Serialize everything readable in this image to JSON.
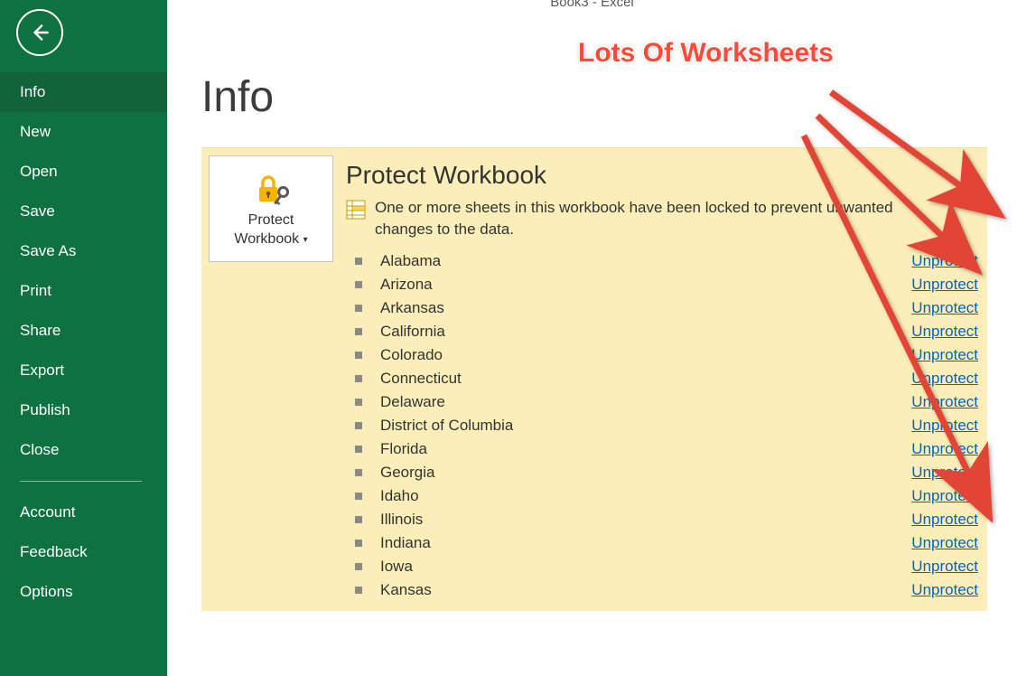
{
  "window_title": "Book3 - Excel",
  "annotation": "Lots Of Worksheets",
  "sidebar": {
    "items": [
      {
        "label": "Info",
        "active": true
      },
      {
        "label": "New"
      },
      {
        "label": "Open"
      },
      {
        "label": "Save"
      },
      {
        "label": "Save As"
      },
      {
        "label": "Print"
      },
      {
        "label": "Share"
      },
      {
        "label": "Export"
      },
      {
        "label": "Publish"
      },
      {
        "label": "Close"
      }
    ],
    "below_divider": [
      {
        "label": "Account"
      },
      {
        "label": "Feedback"
      },
      {
        "label": "Options"
      }
    ]
  },
  "page": {
    "title": "Info",
    "card": {
      "button_line1": "Protect",
      "button_line2": "Workbook",
      "heading": "Protect Workbook",
      "description": "One or more sheets in this workbook have been locked to prevent unwanted changes to the data.",
      "link_label": "Unprotect",
      "sheets": [
        "Alabama",
        "Arizona",
        "Arkansas",
        "California",
        "Colorado",
        "Connecticut",
        "Delaware",
        "District of Columbia",
        "Florida",
        "Georgia",
        "Idaho",
        "Illinois",
        "Indiana",
        "Iowa",
        "Kansas"
      ]
    }
  }
}
